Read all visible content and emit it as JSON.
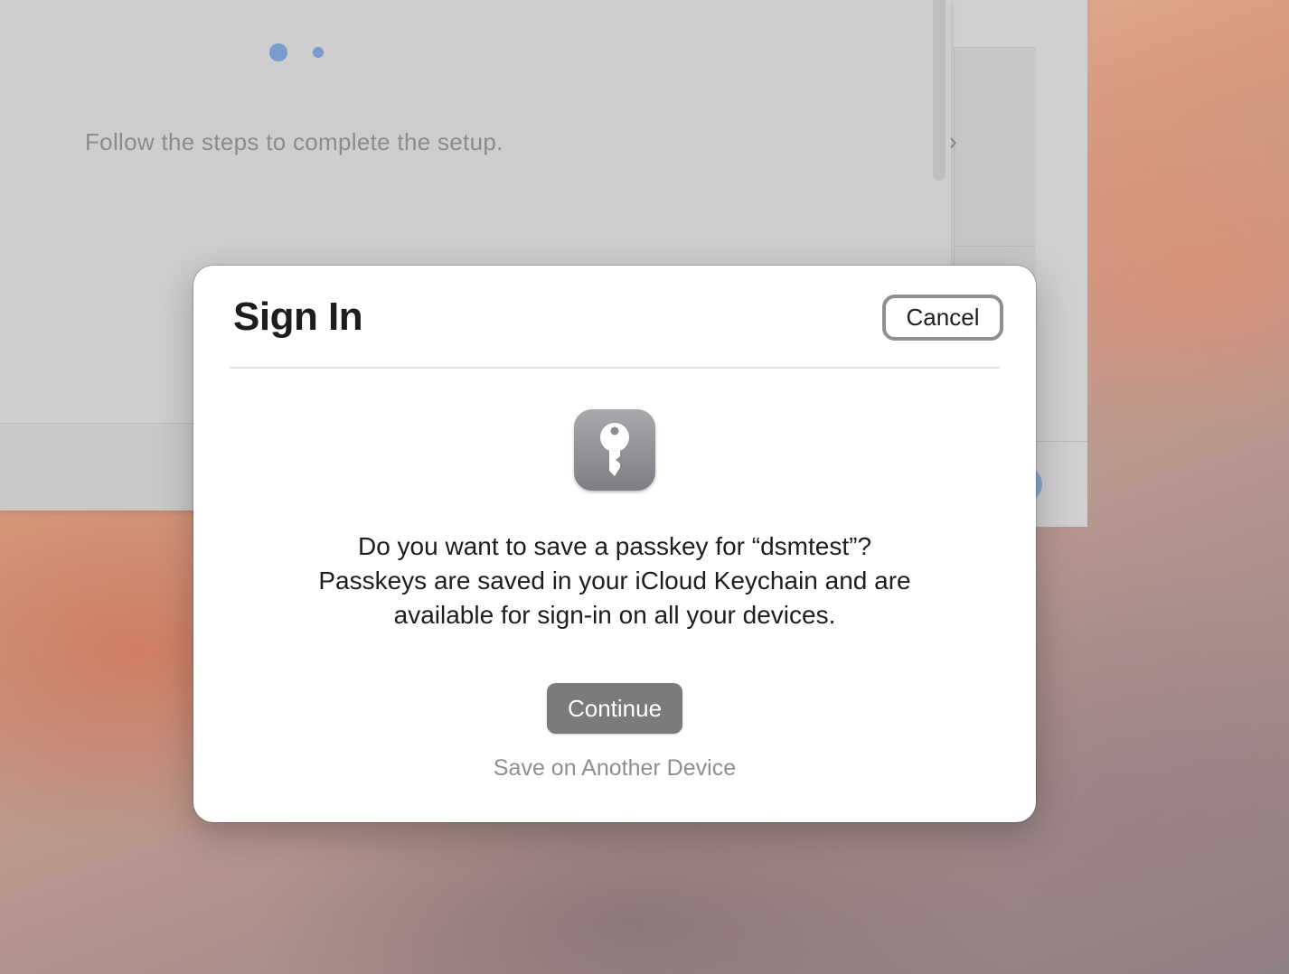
{
  "background_window": {
    "setup_text": "Follow the steps to complete the setup.",
    "steps": {
      "total": 2,
      "current": 1
    },
    "side_chevron": "›"
  },
  "dialog": {
    "title": "Sign In",
    "cancel_label": "Cancel",
    "icon": "key-icon",
    "message_lines": [
      "Do you want to save a passkey for “dsmtest”?",
      "Passkeys are saved in your iCloud Keychain and are",
      "available for sign-in on all your devices."
    ],
    "continue_label": "Continue",
    "alt_option_label": "Save on Another Device"
  },
  "colors": {
    "continue_button": "#7b7b7e",
    "step_dot": "#7a9ccc",
    "dialog_bg": "#ffffff"
  }
}
